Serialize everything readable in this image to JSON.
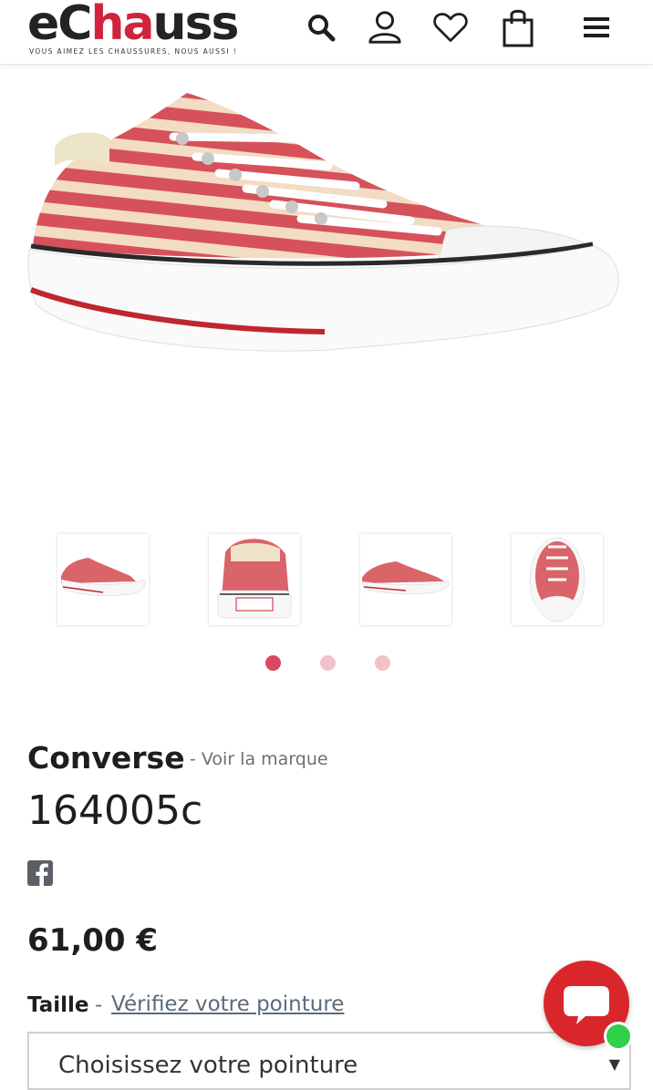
{
  "header": {
    "logo_text_start": "eC",
    "logo_text_accent": "ha",
    "logo_text_end": "uss",
    "tagline": "VOUS AIMEZ LES CHAUSSURES, NOUS AUSSI !",
    "icons": [
      "search-icon",
      "account-icon",
      "wishlist-icon",
      "cart-icon",
      "menu-icon"
    ]
  },
  "gallery": {
    "thumbnails": [
      "side-view",
      "back-view",
      "side-view-2",
      "top-view"
    ],
    "dots": 3,
    "active_dot": 0
  },
  "product": {
    "brand": "Converse",
    "brand_link": "- Voir la marque",
    "model": "164005c",
    "price": "61,00 €",
    "size_label": "Taille",
    "size_separator": "-",
    "size_link": "Vérifiez votre pointure",
    "size_select": "Choisissez votre pointure"
  },
  "colors": {
    "accent": "#d1243c",
    "chat": "#d8262b",
    "online": "#2fd14a",
    "dot_active": "#d9485f",
    "dot_inactive": "#f2c2ca"
  }
}
